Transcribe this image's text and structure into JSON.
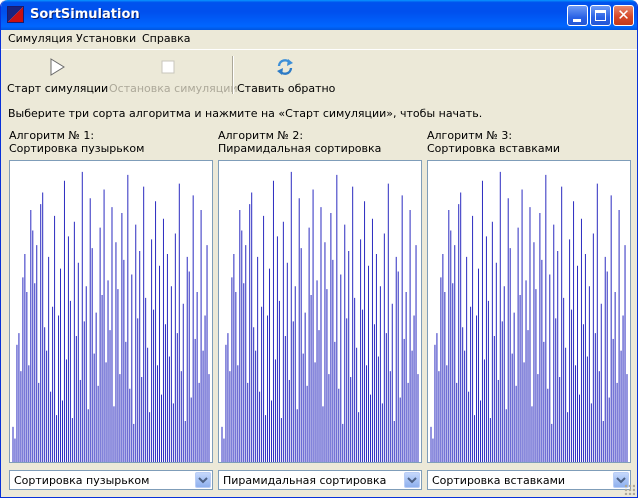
{
  "window": {
    "title": "SortSimulation"
  },
  "menu": [
    "Симуляция",
    "Установки",
    "Справка"
  ],
  "toolbar": {
    "start_label": "Старт симуляции",
    "stop_label": "Остановка симуляции",
    "reset_label": "Ставить обратно"
  },
  "instruction": "Выберите три сорта алгоритма и нажмите на «Старт симуляции», чтобы начать.",
  "colors": {
    "bar": "#2b2bc0",
    "accent": "#0054e3"
  },
  "chart_data": {
    "type": "bar",
    "note_values_shared": true,
    "values": [
      12,
      8,
      40,
      44,
      31,
      63,
      71,
      58,
      33,
      86,
      79,
      61,
      74,
      27,
      88,
      92,
      46,
      38,
      70,
      24,
      53,
      84,
      16,
      50,
      66,
      21,
      96,
      35,
      77,
      55,
      15,
      82,
      43,
      68,
      28,
      99,
      48,
      60,
      18,
      90,
      73,
      37,
      51,
      26,
      80,
      57,
      93,
      34,
      62,
      45,
      87,
      19,
      75,
      59,
      30,
      85,
      69,
      41,
      98,
      25,
      64,
      13,
      81,
      49,
      72,
      29,
      94,
      56,
      39,
      17,
      76,
      52,
      89,
      33,
      67,
      23,
      83,
      47,
      71,
      36,
      60,
      20,
      78,
      44,
      95,
      31,
      54,
      14,
      70,
      65,
      22,
      91,
      42,
      58,
      27,
      86,
      38,
      50,
      74,
      30
    ],
    "ylim": [
      0,
      100
    ]
  },
  "panels": [
    {
      "title": "Алгоритм № 1:",
      "algorithm": "Сортировка пузырьком",
      "selected": "Сортировка пузырьком"
    },
    {
      "title": "Алгоритм № 2:",
      "algorithm": "Пирамидальная сортировка",
      "selected": "Пирамидальная сортировка"
    },
    {
      "title": "Алгоритм № 3:",
      "algorithm": "Сортировка вставками",
      "selected": "Сортировка вставками"
    }
  ]
}
